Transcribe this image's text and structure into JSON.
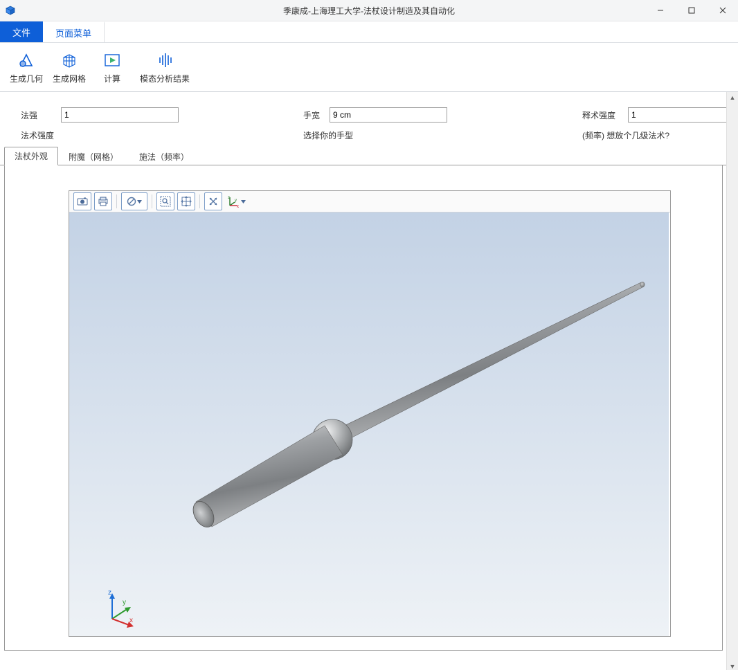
{
  "window": {
    "title": "季康成-上海理工大学-法杖设计制造及其自动化"
  },
  "menu": {
    "file": "文件",
    "page": "页面菜单"
  },
  "ribbon": {
    "geom": "生成几何",
    "mesh": "生成网格",
    "calc": "计算",
    "modal": "模态分析结果"
  },
  "params": {
    "p1": {
      "label": "法强",
      "value": "1",
      "desc": "法术强度"
    },
    "p2": {
      "label": "手宽",
      "value": "9 cm",
      "desc": "选择你的手型"
    },
    "p3": {
      "label": "释术强度",
      "value": "1",
      "desc": "(频率)  想放个几级法术?"
    }
  },
  "subtabs": {
    "t1": "法杖外观",
    "t2": "附魔（网格）",
    "t3": "施法（频率）"
  },
  "triad": {
    "x": "x",
    "y": "y",
    "z": "z"
  }
}
